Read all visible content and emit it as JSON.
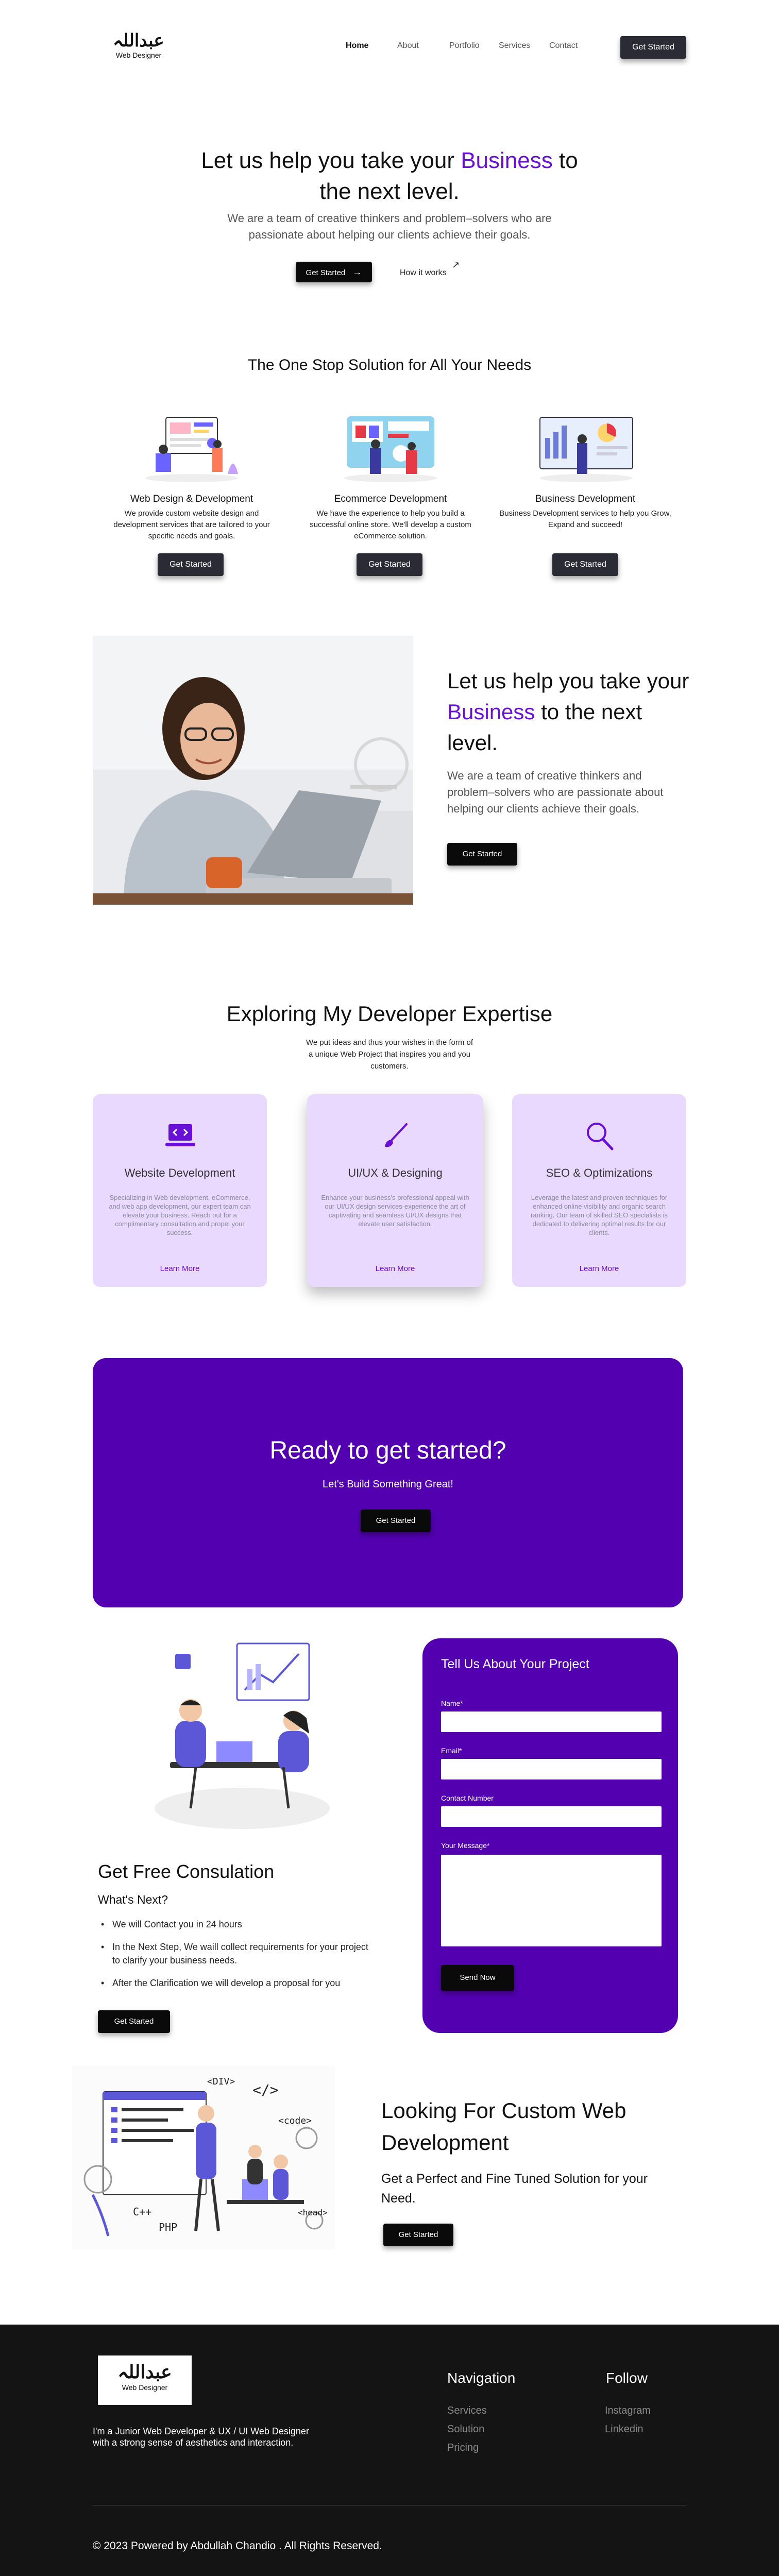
{
  "brand": {
    "logo_text": "عبداللہ",
    "logo_sub": "Web Designer"
  },
  "nav": {
    "items": [
      "Home",
      "About",
      "Portfolio",
      "Services",
      "Contact"
    ],
    "cta": "Get Started"
  },
  "hero": {
    "title_pre": "Let us help you take your ",
    "title_accent": "Business",
    "title_post": " to the next level.",
    "description": "We are a team of creative thinkers and problem–solvers who are passionate about helping our clients achieve their goals.",
    "primary_button": "Get Started",
    "secondary_link": "How it works"
  },
  "solutions": {
    "heading": "The One Stop Solution for All Your Needs",
    "items": [
      {
        "title": "Web Design & Development",
        "description": "We provide custom website design and development services that are tailored to your specific needs and goals.",
        "button": "Get Started"
      },
      {
        "title": "Ecommerce Development",
        "description": "We have the experience to help you build a successful online store. We'll develop a custom eCommerce solution.",
        "button": "Get Started"
      },
      {
        "title": "Business Development",
        "description": "Business Development services to help you Grow, Expand and succeed!",
        "button": "Get Started"
      }
    ]
  },
  "about": {
    "title_pre": "Let us help you take your ",
    "title_accent": "Business",
    "title_post": " to the next level.",
    "description": "We are a team of creative thinkers and problem–solvers who are passionate about helping our clients achieve their goals.",
    "button": "Get Started"
  },
  "expertise": {
    "heading": "Exploring My Developer Expertise",
    "subheading": "We put ideas and thus your wishes in the form of a unique Web Project that inspires you and you customers.",
    "cards": [
      {
        "icon": "laptop-code-icon",
        "title": "Website Development",
        "description": "Specializing in Web development, eCommerce, and web app development, our expert team can elevate your business. Reach out for a complimentary consultation and propel your success.",
        "link": "Learn More"
      },
      {
        "icon": "brush-icon",
        "title": "UI/UX & Designing",
        "description": "Enhance your business's professional appeal with our UI/UX design services-experience the art of captivating and seamless UI/UX designs that elevate user satisfaction.",
        "link": "Learn More"
      },
      {
        "icon": "magnifier-icon",
        "title": "SEO & Optimizations",
        "description": "Leverage the latest and proven techniques for enhanced online visibility and organic search ranking. Our team of skilled SEO specialists is dedicated to delivering optimal results for our clients.",
        "link": "Learn More"
      }
    ]
  },
  "cta": {
    "title": "Ready to get started?",
    "subtitle": "Let's Build Something Great!",
    "button": "Get Started"
  },
  "consultation": {
    "title": "Get Free Consulation",
    "subtitle": "What's Next?",
    "steps": [
      "We will Contact you in 24 hours",
      "In the Next Step, We waill collect requirements for your project to clarify your business needs.",
      "After the Clarification we will develop a proposal for you"
    ],
    "button": "Get Started"
  },
  "form": {
    "title": "Tell Us About Your Project",
    "name_label": "Name*",
    "email_label": "Email*",
    "phone_label": "Contact Number",
    "message_label": "Your Message*",
    "submit": "Send Now"
  },
  "custom": {
    "title": "Looking For Custom Web Development",
    "subtitle": "Get a Perfect and Fine Tuned Solution for your Need.",
    "button": "Get Started",
    "illustration_labels": [
      "<DIV>",
      "</>",
      "<code>",
      "C++",
      "PHP",
      "<head>"
    ]
  },
  "footer": {
    "about": "I'm a Junior Web Developer & UX / UI Web Designer with a strong sense of aesthetics and interaction.",
    "nav_heading": "Navigation",
    "nav_links": [
      "Services",
      "Solution",
      "Pricing"
    ],
    "follow_heading": "Follow",
    "follow_links": [
      "Instagram",
      "Linkedin"
    ],
    "copyright": "© 2023 Powered by Abdullah Chandio . All Rights Reserved."
  },
  "colors": {
    "accent": "#6a0fd6",
    "purple": "#5200b0",
    "card": "#e9d9ff",
    "footer": "#141414"
  }
}
